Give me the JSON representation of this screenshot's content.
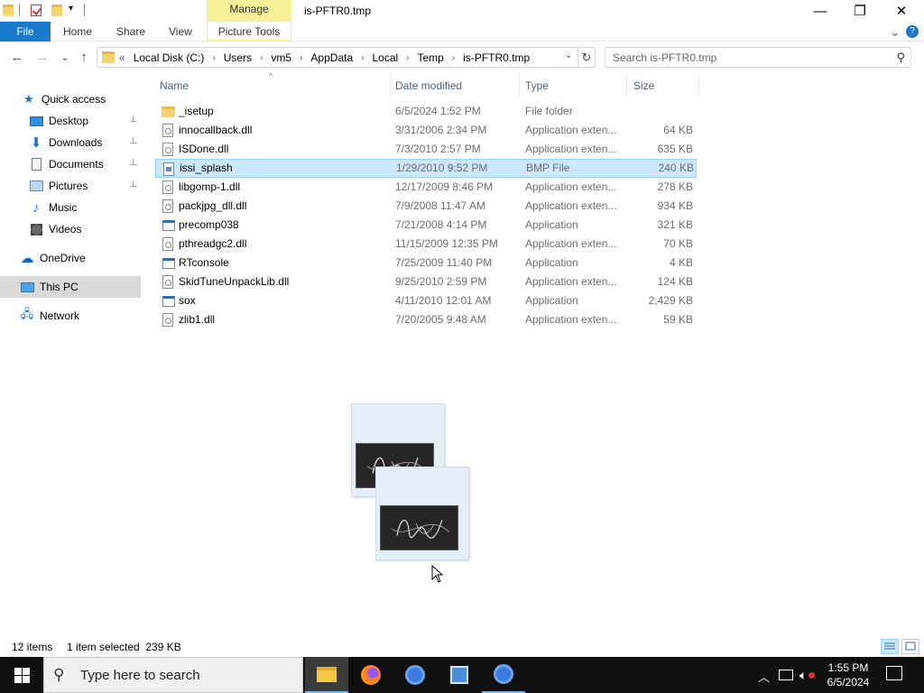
{
  "window": {
    "title": "is-PFTR0.tmp",
    "manage_label": "Manage",
    "minimize_glyph": "—",
    "maximize_glyph": "❐",
    "close_glyph": "✕"
  },
  "ribbon": {
    "file": "File",
    "home": "Home",
    "share": "Share",
    "view": "View",
    "picture_tools": "Picture Tools",
    "expand_glyph": "⌄",
    "help_glyph": "?"
  },
  "nav": {
    "back_glyph": "←",
    "forward_glyph": "→",
    "recent_glyph": "⌄",
    "up_glyph": "↑",
    "overflow": "«",
    "breadcrumb": [
      "Local Disk (C:)",
      "Users",
      "vm5",
      "AppData",
      "Local",
      "Temp",
      "is-PFTR0.tmp"
    ],
    "crumb_sep": "›",
    "dropdown_glyph": "⌄",
    "refresh_glyph": "↻",
    "search_placeholder": "Search is-PFTR0.tmp",
    "search_glyph": "⚲"
  },
  "sidebar": {
    "quick_access": "Quick access",
    "desktop": "Desktop",
    "downloads": "Downloads",
    "documents": "Documents",
    "pictures": "Pictures",
    "music": "Music",
    "videos": "Videos",
    "onedrive": "OneDrive",
    "this_pc": "This PC",
    "network": "Network",
    "pin_glyph": "📌"
  },
  "columns": {
    "name": "Name",
    "date": "Date modified",
    "type": "Type",
    "size": "Size",
    "sort_glyph": "^"
  },
  "files": [
    {
      "name": "_isetup",
      "date": "6/5/2024 1:52 PM",
      "type": "File folder",
      "size": ""
    },
    {
      "name": "innocallback.dll",
      "date": "3/31/2006 2:34 PM",
      "type": "Application exten...",
      "size": "64 KB"
    },
    {
      "name": "ISDone.dll",
      "date": "7/3/2010 2:57 PM",
      "type": "Application exten...",
      "size": "635 KB"
    },
    {
      "name": "issi_splash",
      "date": "1/29/2010 9:52 PM",
      "type": "BMP File",
      "size": "240 KB"
    },
    {
      "name": "libgomp-1.dll",
      "date": "12/17/2009 8:46 PM",
      "type": "Application exten...",
      "size": "278 KB"
    },
    {
      "name": "packjpg_dll.dll",
      "date": "7/9/2008 11:47 AM",
      "type": "Application exten...",
      "size": "934 KB"
    },
    {
      "name": "precomp038",
      "date": "7/21/2008 4:14 PM",
      "type": "Application",
      "size": "321 KB"
    },
    {
      "name": "pthreadgc2.dll",
      "date": "11/15/2009 12:35 PM",
      "type": "Application exten...",
      "size": "70 KB"
    },
    {
      "name": "RTconsole",
      "date": "7/25/2009 11:40 PM",
      "type": "Application",
      "size": "4 KB"
    },
    {
      "name": "SkidTuneUnpackLib.dll",
      "date": "9/25/2010 2:59 PM",
      "type": "Application exten...",
      "size": "124 KB"
    },
    {
      "name": "sox",
      "date": "4/11/2010 12:01 AM",
      "type": "Application",
      "size": "2,429 KB"
    },
    {
      "name": "zlib1.dll",
      "date": "7/20/2005 9:48 AM",
      "type": "Application exten...",
      "size": "59 KB"
    }
  ],
  "status": {
    "items": "12 items",
    "selected": "1 item selected  239 KB"
  },
  "taskbar": {
    "search_text": "Type here to search",
    "search_glyph": "⚲",
    "time": "1:55 PM",
    "date": "6/5/2024",
    "tray_up": "︿"
  }
}
